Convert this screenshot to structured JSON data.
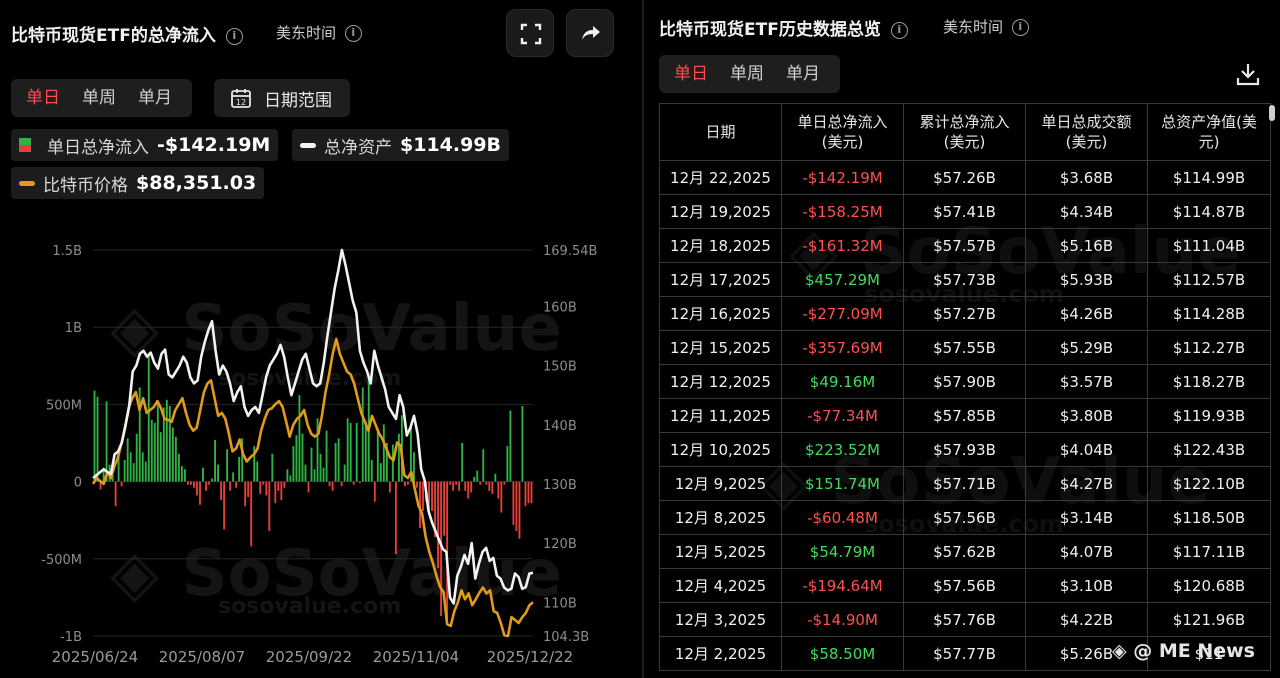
{
  "left": {
    "title": "比特币现货ETF的总净流入",
    "tz": "美东时间",
    "tabs": [
      "单日",
      "单周",
      "单月"
    ],
    "date_range": "日期范围",
    "legend": {
      "flow_label": "单日总净流入",
      "flow_value": "-$142.19M",
      "assets_label": "总净资产",
      "assets_value": "$114.99B",
      "price_label": "比特币价格",
      "price_value": "$88,351.03"
    },
    "colors": {
      "positive": "#2fb344",
      "negative": "#e5403c",
      "assets": "#f2f2f2",
      "price": "#e29a1b",
      "active_tab": "#ff4a4a"
    },
    "icons": [
      "info-icon",
      "fullscreen-icon",
      "share-icon",
      "calendar-icon"
    ]
  },
  "chart_data": {
    "type": "bar",
    "title": "比特币现货ETF的总净流入",
    "xlabel": "",
    "ylabel": "",
    "x_ticks": [
      "2025/06/24",
      "2025/08/07",
      "2025/09/22",
      "2025/11/04",
      "2025/12/22"
    ],
    "y_left_ticks": [
      "1.5B",
      "1B",
      "500M",
      "0",
      "-500M",
      "-1B"
    ],
    "y_left_range": [
      -1000,
      1500
    ],
    "y_right_ticks": [
      "169.54B",
      "160B",
      "150B",
      "140B",
      "130B",
      "120B",
      "110B",
      "104.3B"
    ],
    "y_right_range": [
      104.3,
      169.54
    ],
    "grid": true,
    "legend_position": "top-left",
    "watermark": "SoSoValue",
    "watermark_url": "sosovalue.com",
    "series": [
      {
        "name": "单日总净流入",
        "type": "bar",
        "unit": "M USD",
        "values": [
          590,
          550,
          -50,
          90,
          520,
          110,
          40,
          -160,
          210,
          -30,
          140,
          280,
          190,
          120,
          310,
          610,
          190,
          130,
          830,
          400,
          380,
          520,
          320,
          480,
          530,
          490,
          350,
          290,
          180,
          100,
          80,
          -20,
          -20,
          -40,
          -90,
          -150,
          90,
          -60,
          -20,
          20,
          270,
          110,
          -120,
          -310,
          210,
          -60,
          60,
          -40,
          160,
          280,
          -160,
          -100,
          -420,
          230,
          130,
          -80,
          -20,
          -90,
          -320,
          180,
          -140,
          -60,
          -120,
          -40,
          80,
          40,
          230,
          300,
          560,
          310,
          110,
          -70,
          220,
          80,
          410,
          180,
          90,
          330,
          -30,
          -60,
          250,
          280,
          -30,
          110,
          410,
          380,
          -20,
          380,
          -10,
          610,
          390,
          680,
          140,
          -130,
          340,
          120,
          370,
          250,
          -70,
          240,
          -470,
          310,
          430,
          -30,
          -20,
          350,
          190,
          -40,
          -300,
          -190,
          -130,
          -200,
          -190,
          -360,
          -560,
          -870,
          -350,
          -900,
          -20,
          -60,
          -20,
          -60,
          250,
          -60,
          -110,
          -70,
          30,
          70,
          -20,
          210,
          -20,
          -60,
          -80,
          50,
          -110,
          -200,
          -20,
          230,
          460,
          -280,
          -320,
          -370,
          490,
          -160,
          -140,
          -140
        ]
      },
      {
        "name": "总净资产",
        "type": "line",
        "unit": "B USD",
        "values": [
          131,
          131.5,
          132,
          132.5,
          132,
          131.7,
          135,
          135.5,
          137,
          140,
          143,
          149,
          150,
          152,
          152.5,
          151.5,
          152.2,
          150.5,
          149.5,
          152,
          152.7,
          148.5,
          148,
          149,
          150,
          151.5,
          150.5,
          148,
          147,
          147.5,
          151.5,
          154,
          156,
          157.5,
          152.5,
          148.5,
          150,
          149,
          147,
          144,
          145.5,
          146.5,
          143,
          141.5,
          142.5,
          143,
          142,
          145,
          148,
          150,
          151,
          152,
          153.5,
          151.5,
          148,
          145,
          147,
          149,
          151,
          152,
          149.5,
          147,
          146.5,
          147,
          150.5,
          155,
          159,
          163,
          166,
          169.54,
          167,
          164,
          161,
          159,
          152.5,
          150.5,
          149,
          147,
          152.5,
          150,
          148,
          146,
          143,
          142,
          141,
          145,
          143,
          138.2,
          139.5,
          141.5,
          138.5,
          132.5,
          130.5,
          125.5,
          123.5,
          122,
          120.5,
          119,
          118.5,
          110.8,
          109.8,
          114.5,
          116,
          118,
          116.5,
          120,
          114,
          116.5,
          118.5,
          119.2,
          117,
          117.5,
          114.5,
          114,
          112.5,
          112,
          112.3,
          114.87,
          114.28,
          112.27,
          112.57,
          114.87,
          114.99
        ]
      },
      {
        "name": "比特币价格",
        "type": "line",
        "unit": "B scale",
        "values": [
          130,
          131,
          130.5,
          130,
          132,
          131,
          133,
          134.5,
          137,
          139.5,
          143,
          144.5,
          145.5,
          142.5,
          144.5,
          142,
          142.5,
          143,
          144,
          142.8,
          141,
          140.8,
          140.5,
          142.5,
          143.5,
          144.5,
          142,
          140,
          139,
          139.5,
          142.5,
          145.5,
          147,
          147.5,
          144.5,
          141.5,
          142,
          141,
          138.5,
          135.5,
          136,
          137.5,
          135,
          133.8,
          134.5,
          135,
          136,
          139,
          141,
          142.5,
          142.8,
          143.5,
          144,
          143,
          140.5,
          138,
          140,
          141,
          141.5,
          142.5,
          140,
          138.5,
          138,
          138.5,
          141.5,
          145.5,
          148.5,
          152,
          154.5,
          152,
          150.5,
          149,
          148.5,
          147,
          144.5,
          142,
          140.5,
          139,
          141.5,
          140,
          138.5,
          137.5,
          136,
          134.5,
          134,
          137,
          136.5,
          131.5,
          131,
          132,
          129,
          126.3,
          125,
          121,
          118.5,
          116.7,
          114.5,
          112.6,
          111.7,
          106.3,
          106,
          108.5,
          110,
          112,
          110.5,
          111.5,
          109.5,
          110.5,
          111.6,
          112.5,
          111.5,
          112,
          108.5,
          108.2,
          106.5,
          104.4,
          104.3,
          107.5,
          107,
          106.5,
          107.5,
          108.2,
          109.5,
          110
        ]
      }
    ]
  },
  "right": {
    "title": "比特币现货ETF历史数据总览",
    "tz": "美东时间",
    "tabs": [
      "单日",
      "单周",
      "单月"
    ],
    "columns": [
      "日期",
      "单日总净流入(美元)",
      "累计总净流入(美元)",
      "单日总成交额(美元)",
      "总资产净值(美元)"
    ],
    "rows": [
      [
        "12月 22,2025",
        "-$142.19M",
        "$57.26B",
        "$3.68B",
        "$114.99B"
      ],
      [
        "12月 19,2025",
        "-$158.25M",
        "$57.41B",
        "$4.34B",
        "$114.87B"
      ],
      [
        "12月 18,2025",
        "-$161.32M",
        "$57.57B",
        "$5.16B",
        "$111.04B"
      ],
      [
        "12月 17,2025",
        "$457.29M",
        "$57.73B",
        "$5.93B",
        "$112.57B"
      ],
      [
        "12月 16,2025",
        "-$277.09M",
        "$57.27B",
        "$4.26B",
        "$114.28B"
      ],
      [
        "12月 15,2025",
        "-$357.69M",
        "$57.55B",
        "$5.29B",
        "$112.27B"
      ],
      [
        "12月 12,2025",
        "$49.16M",
        "$57.90B",
        "$3.57B",
        "$118.27B"
      ],
      [
        "12月 11,2025",
        "-$77.34M",
        "$57.85B",
        "$3.80B",
        "$119.93B"
      ],
      [
        "12月 10,2025",
        "$223.52M",
        "$57.93B",
        "$4.04B",
        "$122.43B"
      ],
      [
        "12月 9,2025",
        "$151.74M",
        "$57.71B",
        "$4.27B",
        "$122.10B"
      ],
      [
        "12月 8,2025",
        "-$60.48M",
        "$57.56B",
        "$3.14B",
        "$118.50B"
      ],
      [
        "12月 5,2025",
        "$54.79M",
        "$57.62B",
        "$4.07B",
        "$117.11B"
      ],
      [
        "12月 4,2025",
        "-$194.64M",
        "$57.56B",
        "$3.10B",
        "$120.68B"
      ],
      [
        "12月 3,2025",
        "-$14.90M",
        "$57.76B",
        "$4.22B",
        "$121.96B"
      ],
      [
        "12月 2,2025",
        "$58.50M",
        "$57.77B",
        "$5.26B",
        "$11"
      ]
    ],
    "icons": [
      "info-icon",
      "download-icon"
    ],
    "watermark": "SoSoValue",
    "watermark_url": "sosovalue.com"
  },
  "credit": "ME News"
}
